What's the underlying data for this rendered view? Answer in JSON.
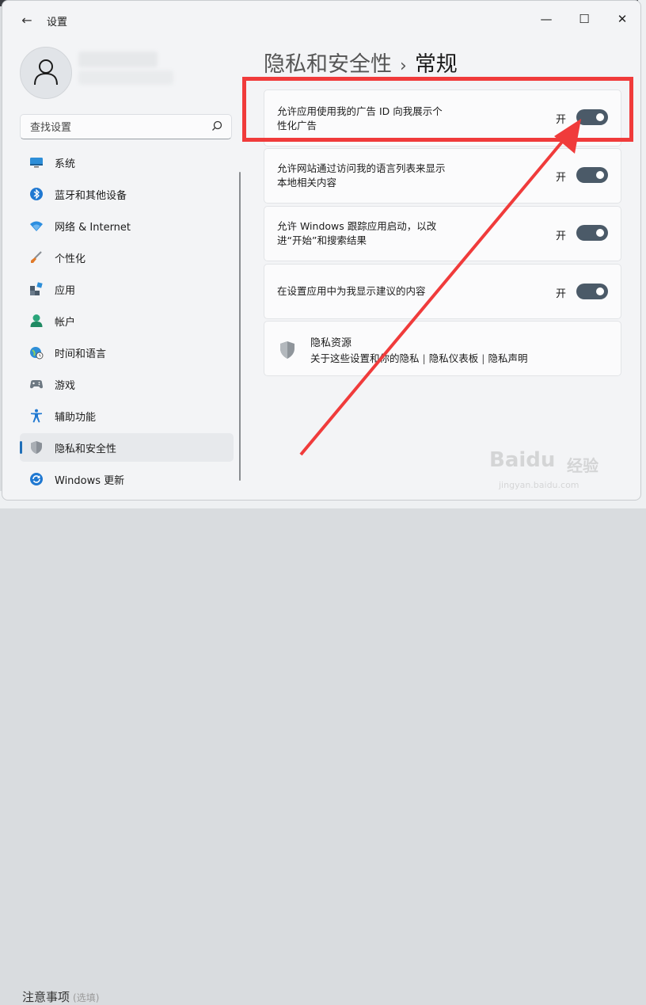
{
  "window": {
    "back_glyph": "←",
    "title": "设置",
    "controls": {
      "minimize": "—",
      "maximize": "☐",
      "close": "✕"
    }
  },
  "sidebar": {
    "search_placeholder": "查找设置",
    "items": [
      {
        "label": "系统",
        "icon": "system-display-icon",
        "active": false
      },
      {
        "label": "蓝牙和其他设备",
        "icon": "bluetooth-icon",
        "active": false
      },
      {
        "label": "网络 & Internet",
        "icon": "wifi-icon",
        "active": false
      },
      {
        "label": "个性化",
        "icon": "brush-icon",
        "active": false
      },
      {
        "label": "应用",
        "icon": "apps-icon",
        "active": false
      },
      {
        "label": "帐户",
        "icon": "account-icon",
        "active": false
      },
      {
        "label": "时间和语言",
        "icon": "globe-clock-icon",
        "active": false
      },
      {
        "label": "游戏",
        "icon": "gamepad-icon",
        "active": false
      },
      {
        "label": "辅助功能",
        "icon": "accessibility-icon",
        "active": false
      },
      {
        "label": "隐私和安全性",
        "icon": "shield-icon",
        "active": true
      },
      {
        "label": "Windows 更新",
        "icon": "update-icon",
        "active": false
      }
    ]
  },
  "main": {
    "breadcrumb": {
      "parent": "隐私和安全性",
      "separator": "›",
      "current": "常规"
    },
    "settings": [
      {
        "text_line1": "允许应用使用我的广告 ID 向我展示个",
        "text_line2": "性化广告",
        "toggle_label": "开",
        "on": true
      },
      {
        "text_line1": "允许网站通过访问我的语言列表来显示",
        "text_line2": "本地相关内容",
        "toggle_label": "开",
        "on": true
      },
      {
        "text_line1": "允许 Windows 跟踪应用启动，以改",
        "text_line2": "进“开始”和搜索结果",
        "toggle_label": "开",
        "on": true
      },
      {
        "text_line1": "在设置应用中为我显示建议的内容",
        "text_line2": "",
        "toggle_label": "开",
        "on": true
      }
    ],
    "privacy_resources": {
      "title": "隐私资源",
      "links": [
        "关于这些设置和你的隐私",
        "隐私仪表板",
        "隐私声明"
      ],
      "divider": "|"
    }
  },
  "background": {
    "bottom_text": "注意事项",
    "bottom_sub": "(选填)"
  },
  "watermark": {
    "brand": "Baidu",
    "cn": "经验",
    "url": "jingyan.baidu.com"
  },
  "colors": {
    "highlight": "#f03b3b",
    "toggle_on": "#4b5a68",
    "accent": "#1f6fb8"
  }
}
